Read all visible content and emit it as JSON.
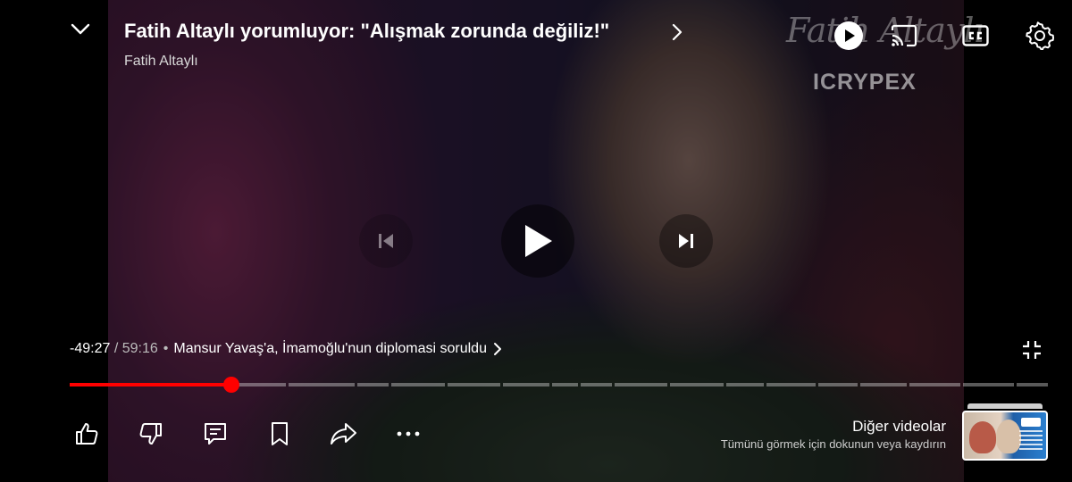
{
  "video": {
    "title": "Fatih Altaylı yorumluyor: \"Alışmak zorunda değiliz!\"",
    "channel": "Fatih Altaylı",
    "watermark_brand": "ICRYPEX"
  },
  "time": {
    "remaining": "-49:27",
    "separator": "/",
    "duration": "59:16",
    "bullet": "•",
    "chapter": "Mansur Yavaş'a, İmamoğlu'nun diplomasi soruldu"
  },
  "progress": {
    "played_fraction": 0.165,
    "color": "#ff0000"
  },
  "more_videos": {
    "title": "Diğer videolar",
    "subtitle": "Tümünü görmek için dokunun veya kaydırın"
  },
  "icons": {
    "top": [
      "chevron-down-icon",
      "autoplay-toggle-icon",
      "cast-icon",
      "captions-icon",
      "settings-icon"
    ],
    "center": [
      "previous-icon",
      "play-icon",
      "next-icon"
    ],
    "actions": [
      "like-icon",
      "dislike-icon",
      "comments-icon",
      "save-icon",
      "share-icon",
      "more-icon"
    ],
    "other": [
      "exit-fullscreen-icon"
    ]
  }
}
